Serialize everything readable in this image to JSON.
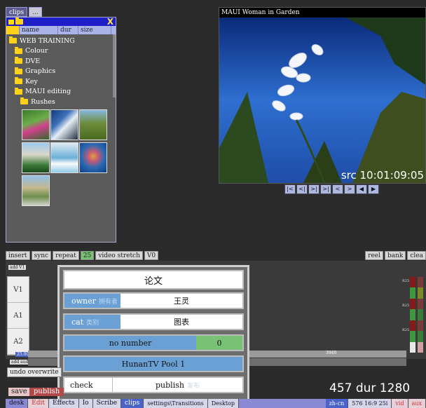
{
  "top_tabs": [
    "clips",
    "..."
  ],
  "clips_window": {
    "close": "X",
    "columns": [
      "name",
      "dur",
      "size"
    ],
    "tree": [
      {
        "label": "WEB TRAINING",
        "level": 0
      },
      {
        "label": "Colour",
        "level": 1
      },
      {
        "label": "DVE",
        "level": 1
      },
      {
        "label": "Graphics",
        "level": 1
      },
      {
        "label": "Key",
        "level": 1
      },
      {
        "label": "MAUI editing",
        "level": 1
      },
      {
        "label": "Rushes",
        "level": 2
      }
    ],
    "thumbnails": 7
  },
  "viewer": {
    "title": "MAUI Woman in Garden",
    "timecode": "src 10:01:09:05",
    "transport": [
      "|<",
      "<|",
      ">|",
      ">|",
      "<",
      ">",
      "◀",
      "▶"
    ]
  },
  "timeline_toolbar": [
    "insert",
    "sync",
    "repeat",
    "25",
    "video stretch",
    "V0"
  ],
  "timeline_right": [
    "reel",
    "bank",
    "clea"
  ],
  "tracks": {
    "add_v": "add V1",
    "labels": [
      "V1",
      "A1",
      "A2"
    ],
    "rate": "25.00",
    "add_audio": "add audio",
    "ruler_mark": "3940"
  },
  "meter_labels": [
    "R25",
    "R25",
    "R25"
  ],
  "popup": {
    "title": "论文",
    "owner_label": "owner",
    "owner_ghost": "拥有者",
    "owner_value": "王灵",
    "cat_label": "cat",
    "cat_ghost": "类别",
    "cat_value": "图表",
    "no_number_label": "no number",
    "no_number_value": "0",
    "pool": "HunanTV Pool 1",
    "check_label": "check",
    "publish_label": "publish",
    "publish_ghost": "发布"
  },
  "undo_label": "undo overwrite",
  "save_label": "save",
  "publish_label": "publish",
  "duration": "457 dur 1280",
  "bottom_bar": [
    "desk",
    "Edit",
    "Effects",
    "Io",
    "Scribe",
    "clips",
    "settings\\Transitions",
    "Desktop"
  ],
  "bottom_right": [
    "zh-cn",
    "576 16:9 25i",
    "vid",
    "aux"
  ]
}
